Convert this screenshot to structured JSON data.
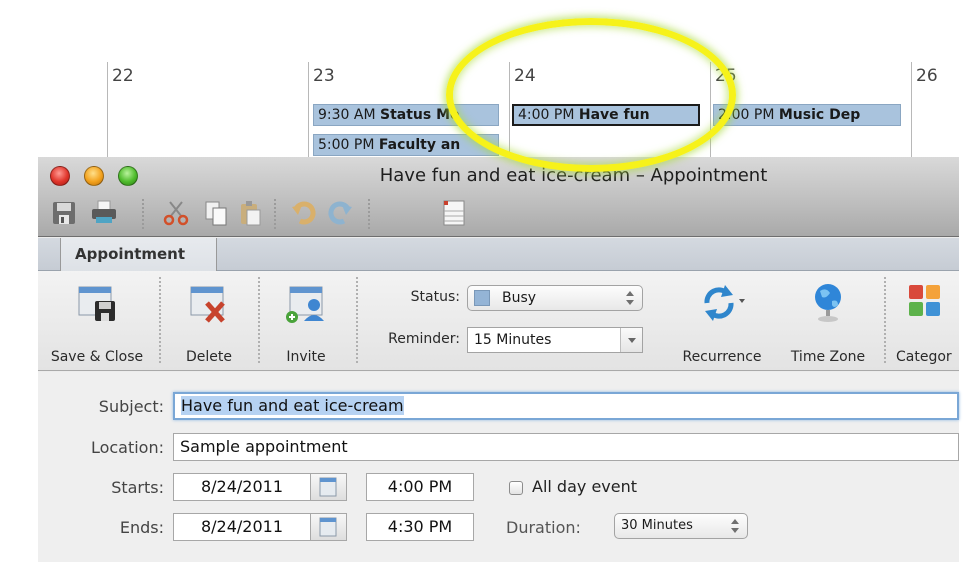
{
  "calendar": {
    "days": [
      {
        "label": "22",
        "events": []
      },
      {
        "label": "23",
        "events": [
          {
            "time": "9:30 AM",
            "title": "Status Me"
          },
          {
            "time": "5:00 PM",
            "title": "Faculty an"
          }
        ]
      },
      {
        "label": "24",
        "events": [
          {
            "time": "4:00 PM",
            "title": "Have fun",
            "selected": true
          }
        ]
      },
      {
        "label": "25",
        "events": [
          {
            "time": "2:00 PM",
            "title": "Music Dep"
          }
        ]
      },
      {
        "label": "26",
        "events": []
      }
    ],
    "highlight_color": "#f6f21a"
  },
  "window": {
    "title": "Have fun and eat ice-cream – Appointment",
    "traffic_lights": [
      "close",
      "minimize",
      "zoom"
    ],
    "toolbar_icons": [
      "save-icon",
      "print-icon",
      "cut-icon",
      "copy-icon",
      "paste-icon",
      "undo-icon",
      "redo-icon",
      "calendar-view-icon"
    ],
    "tabs": [
      {
        "label": "Appointment",
        "active": true
      }
    ],
    "ribbon": {
      "buttons": {
        "save_close": "Save & Close",
        "delete": "Delete",
        "invite": "Invite",
        "recurrence": "Recurrence",
        "time_zone": "Time Zone",
        "categorize": "Categor"
      },
      "status": {
        "label": "Status:",
        "value": "Busy",
        "swatch_color": "#94b4d6"
      },
      "reminder": {
        "label": "Reminder:",
        "value": "15 Minutes"
      }
    },
    "form": {
      "subject": {
        "label": "Subject:",
        "value": "Have fun and eat ice-cream"
      },
      "location": {
        "label": "Location:",
        "value": "Sample appointment"
      },
      "starts": {
        "label": "Starts:",
        "date": "8/24/2011",
        "time": "4:00 PM"
      },
      "ends": {
        "label": "Ends:",
        "date": "8/24/2011",
        "time": "4:30 PM"
      },
      "all_day": {
        "label": "All day event",
        "checked": false
      },
      "duration": {
        "label": "Duration:",
        "value": "30 Minutes"
      }
    }
  }
}
